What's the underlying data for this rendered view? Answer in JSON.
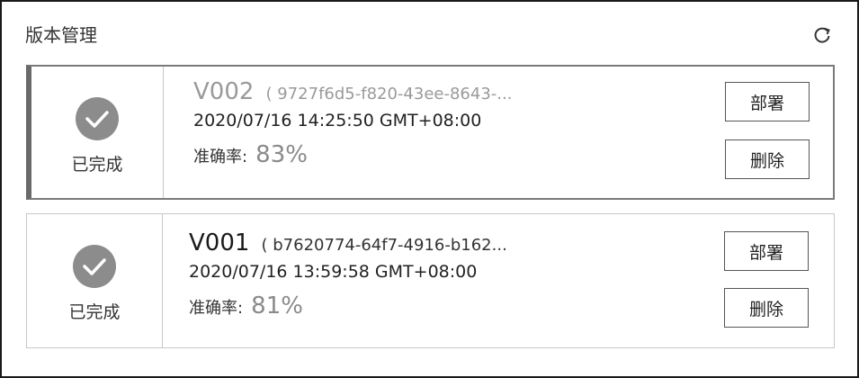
{
  "panel": {
    "title": "版本管理",
    "refresh_icon": "refresh-icon"
  },
  "versions": [
    {
      "status": "已完成",
      "status_icon": "check-circle-icon",
      "name": "V002",
      "id_text": "( 9727f6d5-f820-43ee-8643-...",
      "timestamp": "2020/07/16 14:25:50 GMT+08:00",
      "accuracy_label": "准确率:",
      "accuracy_value": "83%",
      "deploy_label": "部署",
      "delete_label": "删除",
      "selected": true
    },
    {
      "status": "已完成",
      "status_icon": "check-circle-icon",
      "name": "V001",
      "id_text": "( b7620774-64f7-4916-b162...",
      "timestamp": "2020/07/16 13:59:58 GMT+08:00",
      "accuracy_label": "准确率:",
      "accuracy_value": "81%",
      "deploy_label": "部署",
      "delete_label": "删除",
      "selected": false
    }
  ]
}
